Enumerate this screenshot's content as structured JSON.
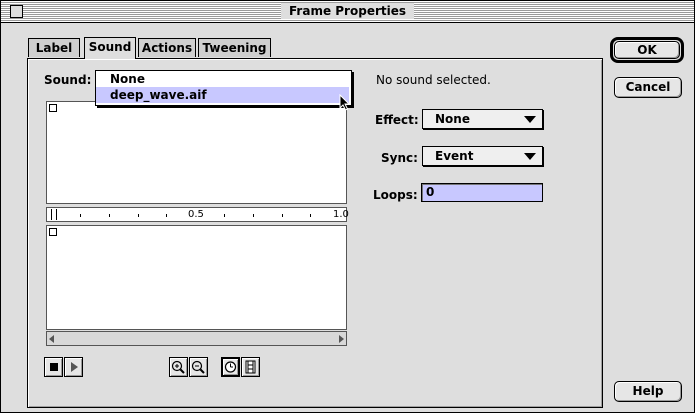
{
  "window": {
    "title": "Frame Properties"
  },
  "tabs": [
    {
      "label": "Label"
    },
    {
      "label": "Sound"
    },
    {
      "label": "Actions"
    },
    {
      "label": "Tweening"
    }
  ],
  "sound": {
    "label": "Sound:",
    "menu_items": [
      "None",
      "deep_wave.aif"
    ],
    "selected": "deep_wave.aif",
    "status": "No sound selected.",
    "ruler_labels": [
      "0.5",
      "1.0"
    ]
  },
  "effect": {
    "label": "Effect:",
    "value": "None"
  },
  "sync": {
    "label": "Sync:",
    "value": "Event"
  },
  "loops": {
    "label": "Loops:",
    "value": "0"
  },
  "buttons": {
    "ok": "OK",
    "cancel": "Cancel",
    "help": "Help"
  },
  "controls": {
    "icons": [
      "stop-icon",
      "play-icon",
      "zoom-in-icon",
      "zoom-out-icon",
      "time-units-icon",
      "frames-units-icon"
    ]
  }
}
